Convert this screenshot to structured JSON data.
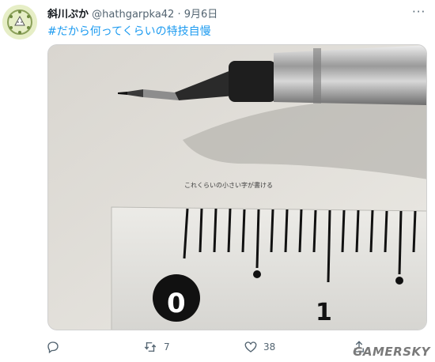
{
  "tweet": {
    "display_name": "斜川ぷか",
    "handle": "@hathgarpka42",
    "separator": " · ",
    "date": "9月6日",
    "hashtag": "#だから何ってくらいの特技自慢",
    "photo_handwriting": "これくらいの小さい字が書ける",
    "ruler_labels": [
      "0",
      "1"
    ]
  },
  "actions": {
    "reply_count": "",
    "retweet_count": "7",
    "like_count": "38"
  },
  "watermark": "GAMERSKY",
  "colors": {
    "link": "#1d9bf0",
    "muted": "#536471",
    "text": "#0f1419"
  }
}
